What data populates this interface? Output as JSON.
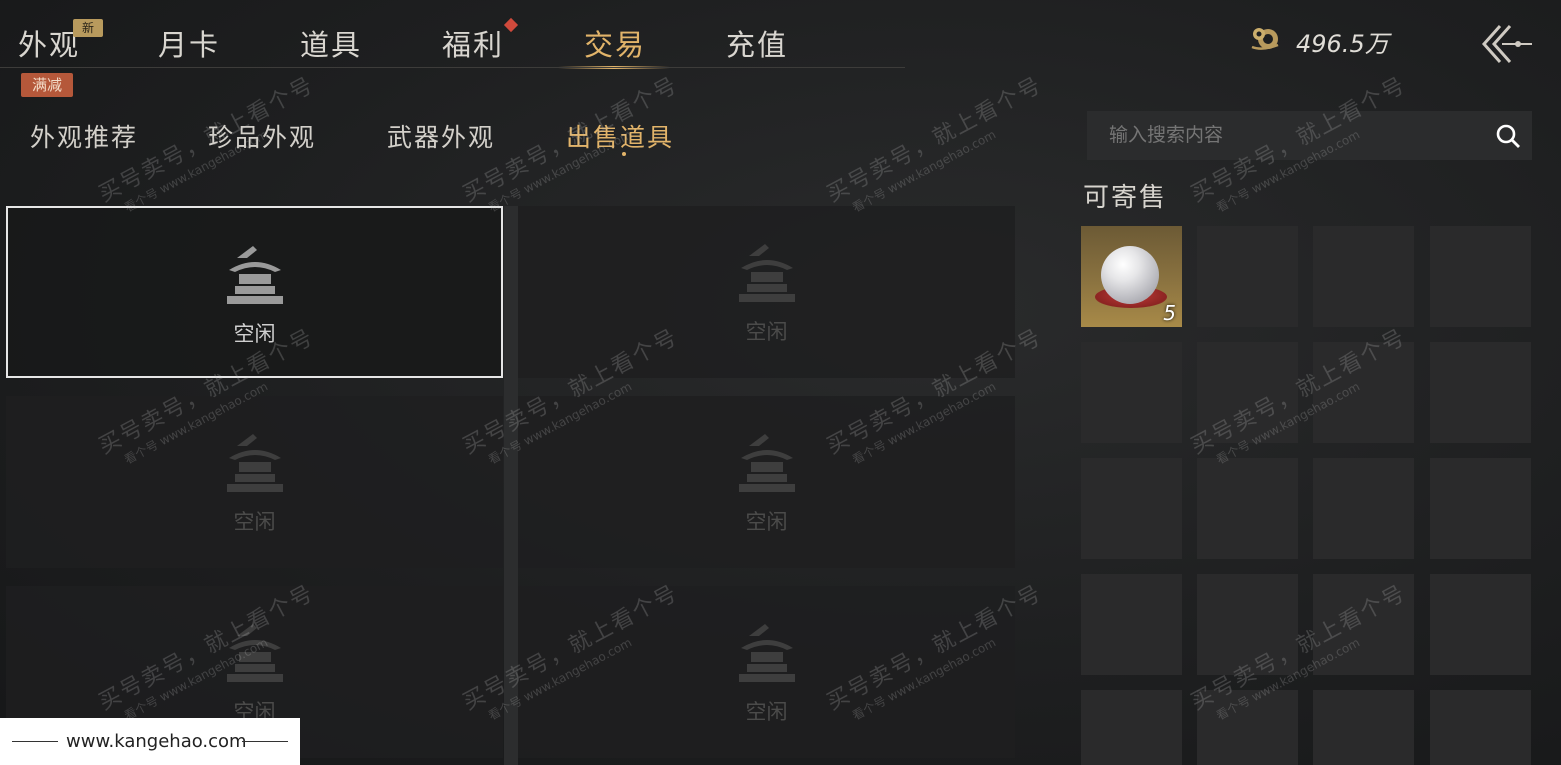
{
  "nav": {
    "tabs": [
      {
        "label": "外观"
      },
      {
        "label": "月卡"
      },
      {
        "label": "道具"
      },
      {
        "label": "福利"
      },
      {
        "label": "交易"
      },
      {
        "label": "充值"
      }
    ],
    "active": "交易",
    "badge_new": "新",
    "badge_sale": "满减"
  },
  "currency": {
    "value": "496.5万",
    "icon": "currency-coin-icon"
  },
  "subtabs": [
    {
      "label": "外观推荐"
    },
    {
      "label": "珍品外观"
    },
    {
      "label": "武器外观"
    },
    {
      "label": "出售道具"
    }
  ],
  "slots": {
    "empty_label": "空闲"
  },
  "search": {
    "placeholder": "输入搜索内容"
  },
  "sellable": {
    "title": "可寄售",
    "items": [
      {
        "name": "pearl",
        "quantity": "5"
      }
    ]
  },
  "watermark": {
    "text": "买号卖号，就上看个号",
    "url": "www.kangehao.com",
    "sub": "看个号"
  },
  "footer": {
    "url": "www.kangehao.com"
  },
  "colors": {
    "accent": "#e2b46a",
    "sale_badge": "#b5583a",
    "new_badge": "#b89a5d",
    "dot": "#d04a3c"
  }
}
